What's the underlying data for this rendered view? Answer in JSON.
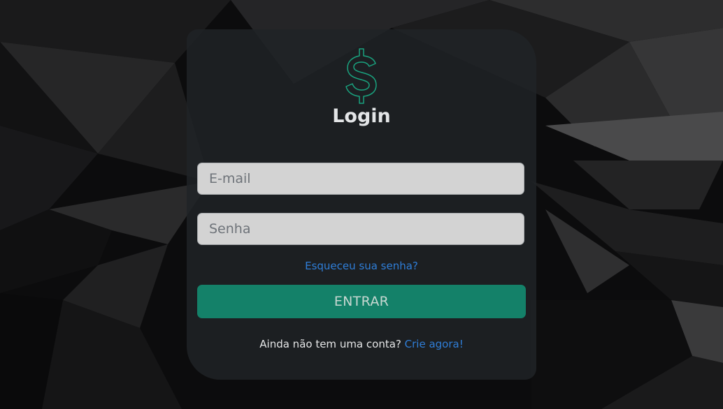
{
  "page": {
    "title": "Login"
  },
  "form": {
    "email_placeholder": "E-mail",
    "password_placeholder": "Senha",
    "forgot_link": "Esqueceu sua senha?",
    "submit_label": "ENTRAR",
    "signup_prompt": "Ainda não tem uma conta?",
    "signup_link": "Crie agora!"
  },
  "icons": {
    "logo": "dollar-sign-icon"
  },
  "colors": {
    "accent": "#148169",
    "link": "#2f7ed8",
    "card": "#1f2327",
    "logo_stroke": "#1aa37f"
  }
}
